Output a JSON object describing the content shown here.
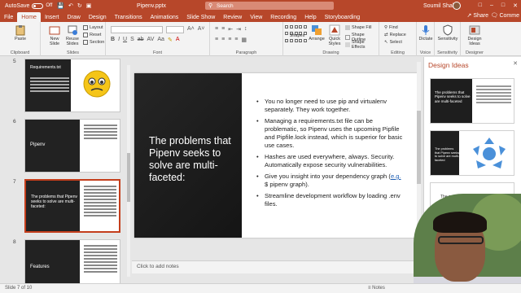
{
  "titlebar": {
    "autosave_label": "AutoSave",
    "autosave_state": "Off",
    "doc_title": "Pipenv.pptx",
    "search_placeholder": "Search",
    "user_name": "Soumil Shah"
  },
  "menu": {
    "tabs": [
      "File",
      "Home",
      "Insert",
      "Draw",
      "Design",
      "Transitions",
      "Animations",
      "Slide Show",
      "Review",
      "View",
      "Recording",
      "Help",
      "Storyboarding"
    ],
    "active": "Home",
    "share_label": "Share",
    "comments_label": "Comme"
  },
  "ribbon": {
    "clipboard": {
      "paste": "Paste",
      "label": "Clipboard"
    },
    "slides": {
      "new_slide": "New Slide",
      "reuse_slides": "Reuse Slides",
      "layout": "Layout",
      "reset": "Reset",
      "section": "Section",
      "label": "Slides"
    },
    "font": {
      "label": "Font"
    },
    "paragraph": {
      "label": "Paragraph"
    },
    "drawing": {
      "shapes": "Shapes",
      "arrange": "Arrange",
      "quick_styles": "Quick Styles",
      "shape_fill": "Shape Fill",
      "shape_outline": "Shape Outline",
      "shape_effects": "Shape Effects",
      "label": "Drawing"
    },
    "editing": {
      "find": "Find",
      "replace": "Replace",
      "select": "Select",
      "label": "Editing"
    },
    "voice": {
      "dictate": "Dictate",
      "label": "Voice"
    },
    "sensitivity": {
      "sensitivity": "Sensitivity",
      "label": "Sensitivity"
    },
    "designer": {
      "design_ideas": "Design Ideas",
      "label": "Designer"
    }
  },
  "thumbnails": [
    {
      "num": "5",
      "title": "Requirements.txt"
    },
    {
      "num": "6",
      "title": "Pipenv"
    },
    {
      "num": "7",
      "title": "The problems that Pipenv seeks to solve are multi-faceted:",
      "selected": true
    },
    {
      "num": "8",
      "title": "Features"
    }
  ],
  "slide": {
    "title": "The problems that Pipenv seeks to solve are multi-faceted:",
    "bullets": [
      {
        "text": "You no longer need to use pip and virtualenv separately. They work together."
      },
      {
        "text": "Managing a requirements.txt file can be problematic, so Pipenv uses the upcoming Pipfile and Pipfile.lock instead, which is superior for basic use cases."
      },
      {
        "text": "Hashes are used everywhere, always. Security. Automatically expose security vulnerabilities."
      },
      {
        "text_before": "Give you insight into your dependency graph (",
        "link": "e.g.",
        "text_after": " $ pipenv graph)."
      },
      {
        "text": "Streamline development workflow by loading .env files."
      }
    ],
    "notes_placeholder": "Click to add notes"
  },
  "design_pane": {
    "title": "Design Ideas",
    "ideas": [
      {
        "title": "The problems that Pipenv seeks to solve are multi-faceted"
      },
      {
        "title": "The problems that Pipenv seeks to solve are multi-faceted"
      },
      {
        "title": "The problems"
      }
    ]
  },
  "statusbar": {
    "slide_indicator": "Slide 7 of 10",
    "notes": "Notes"
  },
  "colors": {
    "accent": "#b7472a",
    "slide_dark": "#1d1d1d",
    "selected_border": "#c43e1c"
  }
}
